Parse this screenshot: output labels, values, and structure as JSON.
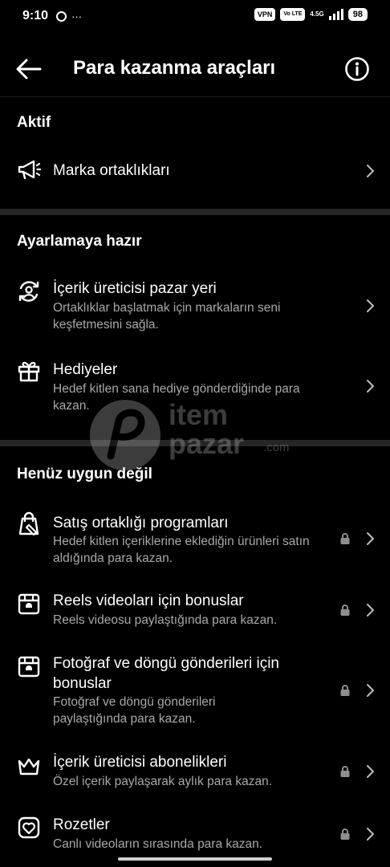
{
  "status": {
    "time": "9:10",
    "dots": "···",
    "vpn": "VPN",
    "volte": "Vo LTE",
    "network": "4.5G",
    "battery": "98"
  },
  "header": {
    "title": "Para kazanma araçları"
  },
  "sections": {
    "active": "Aktif",
    "ready": "Ayarlamaya hazır",
    "not_yet": "Henüz uygun değil"
  },
  "items": [
    {
      "title": "Marka ortaklıkları",
      "subtitle": "",
      "icon": "megaphone-icon",
      "locked": false
    },
    {
      "title": "İçerik üreticisi pazar yeri",
      "subtitle": "Ortaklıklar başlatmak için markaların seni keşfetmesini sağla.",
      "icon": "creator-marketplace-icon",
      "locked": false
    },
    {
      "title": "Hediyeler",
      "subtitle": "Hedef kitlen sana hediye gönderdiğinde para kazan.",
      "icon": "gift-icon",
      "locked": false
    },
    {
      "title": "Satış ortaklığı programları",
      "subtitle": "Hedef kitlen içeriklerine eklediğin ürünleri satın aldığında para kazan.",
      "icon": "shopping-bag-icon",
      "locked": true
    },
    {
      "title": "Reels videoları için bonuslar",
      "subtitle": "Reels videosu paylaştığında para kazan.",
      "icon": "bonus-box-icon",
      "locked": true
    },
    {
      "title": "Fotoğraf ve döngü gönderileri için bonuslar",
      "subtitle": "Fotoğraf ve döngü gönderileri paylaştığında para kazan.",
      "icon": "bonus-box-icon",
      "locked": true
    },
    {
      "title": "İçerik üreticisi abonelikleri",
      "subtitle": "Özel içerik paylaşarak aylık para kazan.",
      "icon": "crown-icon",
      "locked": true
    },
    {
      "title": "Rozetler",
      "subtitle": "Canlı videoların sırasında para kazan.",
      "icon": "heart-badge-icon",
      "locked": true
    }
  ],
  "watermark": {
    "line1": "item",
    "line2": "pazar",
    "suffix": ".com"
  }
}
